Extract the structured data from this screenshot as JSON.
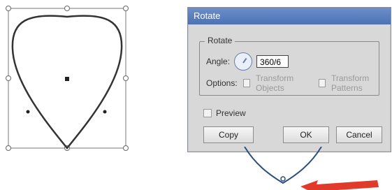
{
  "dialog": {
    "title": "Rotate",
    "group_title": "Rotate",
    "angle_label": "Angle:",
    "angle_value": "360/6",
    "options_label": "Options:",
    "transform_objects_label": "Transform Objects",
    "transform_patterns_label": "Transform Patterns",
    "preview_label": "Preview",
    "copy_label": "Copy",
    "ok_label": "OK",
    "cancel_label": "Cancel"
  },
  "icons": {
    "angle_dial": "angle-dial-icon",
    "transform_handle": "transform-handle-icon",
    "center_point": "center-point-icon",
    "arrow": "red-arrow-icon"
  },
  "colors": {
    "titlebar": "#5a7fc0",
    "dialog_bg": "#d8d8d8",
    "shape_stroke": "#333333",
    "arrow": "#e13a2a"
  }
}
